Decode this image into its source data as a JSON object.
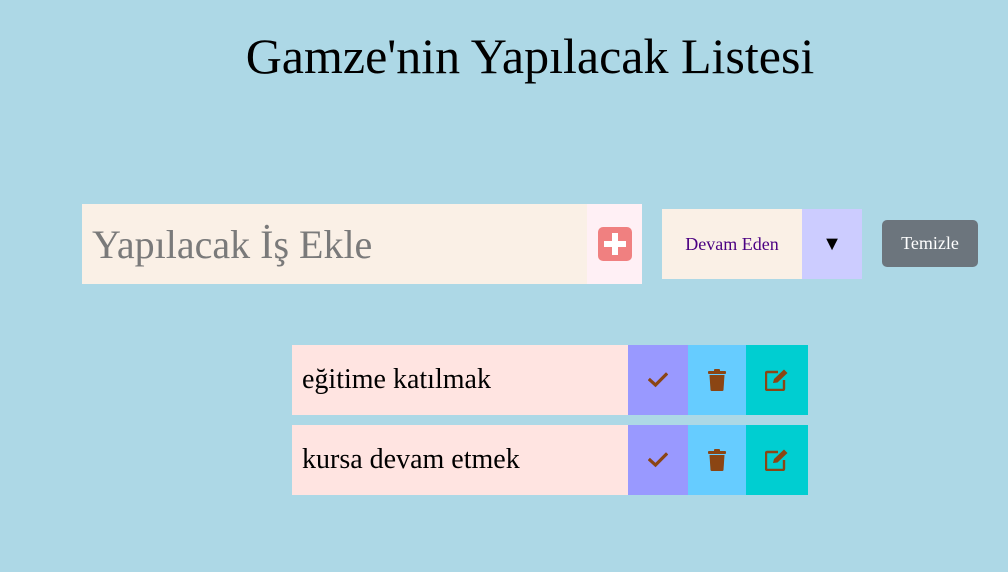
{
  "header": {
    "title": "Gamze'nin Yapılacak Listesi"
  },
  "form": {
    "input_placeholder": "Yapılacak İş Ekle",
    "input_value": "",
    "add_icon": "plus-square-icon",
    "filter_selected": "Devam Eden",
    "filter_arrow": "▼",
    "clear_label": "Temizle"
  },
  "todos": [
    {
      "text": "eğitime katılmak"
    },
    {
      "text": "kursa devam etmek"
    }
  ],
  "colors": {
    "background": "#add8e6",
    "input_bg": "#faf0e6",
    "add_button_bg": "#fff0f5",
    "add_icon": "#f08080",
    "filter_arrow_bg": "#ccccff",
    "filter_text": "#4b0082",
    "clear_button_bg": "#6c757d",
    "todo_bg": "#ffe4e1",
    "complete_bg": "#9999ff",
    "delete_bg": "#66ccff",
    "edit_bg": "#00ced1",
    "action_icon": "#8b4513"
  },
  "icons": {
    "complete": "check-icon",
    "delete": "trash-icon",
    "edit": "edit-icon"
  }
}
